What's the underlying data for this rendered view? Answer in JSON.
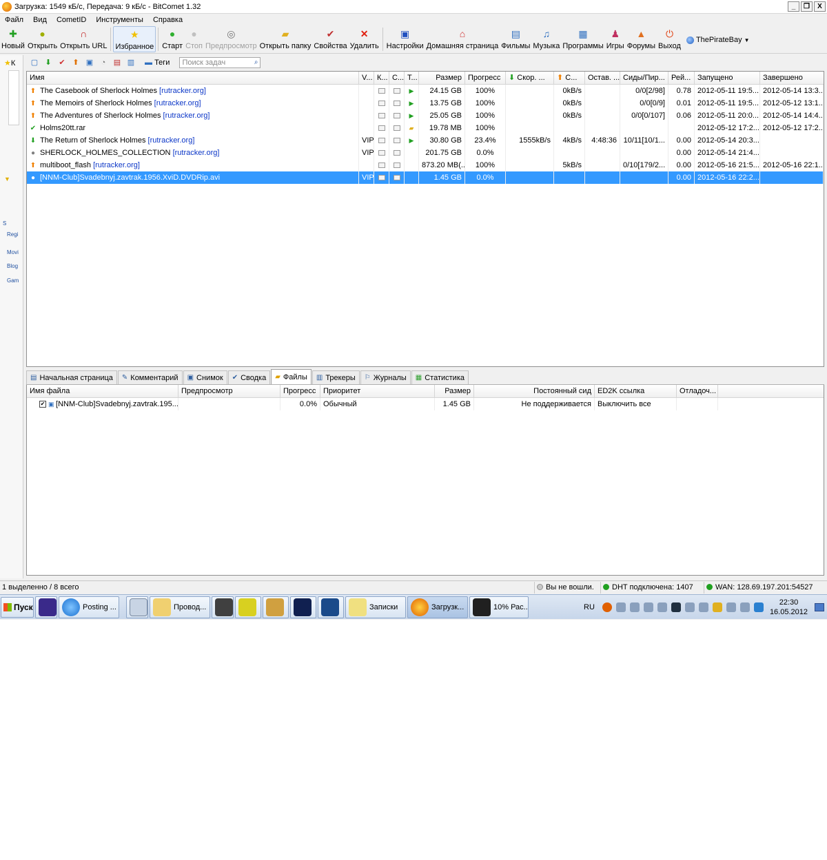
{
  "window": {
    "title": "Загрузка: 1549 кБ/с, Передача: 9 кБ/с - BitComet 1.32",
    "controls": [
      "_",
      "❐",
      "X"
    ]
  },
  "menu": [
    "Файл",
    "Вид",
    "CometID",
    "Инструменты",
    "Справка"
  ],
  "toolbar": {
    "new": "Новый",
    "open": "Открыть",
    "open_url": "Открыть URL",
    "favorites": "Избранное",
    "start": "Старт",
    "stop": "Стоп",
    "preview": "Предпросмотр",
    "open_folder": "Открыть папку",
    "properties": "Свойства",
    "delete": "Удалить",
    "settings": "Настройки",
    "homepage": "Домашняя страница",
    "movies": "Фильмы",
    "music": "Музыка",
    "programs": "Программы",
    "games": "Игры",
    "forums": "Форумы",
    "exit": "Выход",
    "site": "ThePirateBay"
  },
  "sidebar": {
    "label_k": "К",
    "items": [
      "S",
      "Regi",
      "Movi",
      "Blog",
      "Gam"
    ]
  },
  "tasks_toolbar": {
    "tags_label": "Теги",
    "search_placeholder": "Поиск задач"
  },
  "task_columns": [
    "Имя",
    "V...",
    "К...",
    "С...",
    "Т...",
    "Размер",
    "Прогресс",
    "Скор. ...",
    "С...",
    "Остав. ...",
    "Сиды/Пир...",
    "Рей...",
    "Запущено",
    "Завершено"
  ],
  "tasks": [
    {
      "state": "up",
      "name": "The Casebook of Sherlock Holmes",
      "tag": "[rutracker.org]",
      "vip": "",
      "t": "play",
      "size": "24.15 GB",
      "progress": "100%",
      "down": "",
      "up": "0kB/s",
      "left": "",
      "seeds": "0/0[2/98]",
      "ratio": "0.78",
      "started": "2012-05-11 19:5...",
      "finished": "2012-05-14 13:3..."
    },
    {
      "state": "up",
      "name": "The Memoirs of Sherlock Holmes",
      "tag": "[rutracker.org]",
      "vip": "",
      "t": "play",
      "size": "13.75 GB",
      "progress": "100%",
      "down": "",
      "up": "0kB/s",
      "left": "",
      "seeds": "0/0[0/9]",
      "ratio": "0.01",
      "started": "2012-05-11 19:5...",
      "finished": "2012-05-12 13:1..."
    },
    {
      "state": "up",
      "name": "The Adventures of Sherlock Holmes",
      "tag": "[rutracker.org]",
      "vip": "",
      "t": "play",
      "size": "25.05 GB",
      "progress": "100%",
      "down": "",
      "up": "0kB/s",
      "left": "",
      "seeds": "0/0[0/107]",
      "ratio": "0.06",
      "started": "2012-05-11 20:0...",
      "finished": "2012-05-14 14:4..."
    },
    {
      "state": "done",
      "name": "Holms20tt.rar",
      "tag": "",
      "vip": "",
      "t": "folder",
      "size": "19.78 MB",
      "progress": "100%",
      "down": "",
      "up": "",
      "left": "",
      "seeds": "",
      "ratio": "",
      "started": "2012-05-12 17:2...",
      "finished": "2012-05-12 17:2..."
    },
    {
      "state": "down",
      "name": "The Return of Sherlock Holmes",
      "tag": "[rutracker.org]",
      "vip": "VIP",
      "t": "play",
      "size": "30.80 GB",
      "progress": "23.4%",
      "down": "1555kB/s",
      "up": "4kB/s",
      "left": "4:48:36",
      "seeds": "10/11[10/1...",
      "ratio": "0.00",
      "started": "2012-05-14 20:3...",
      "finished": ""
    },
    {
      "state": "stop",
      "name": "SHERLOCK_HOLMES_COLLECTION",
      "tag": "[rutracker.org]",
      "vip": "VIP",
      "t": "",
      "size": "201.75 GB",
      "progress": "0.0%",
      "down": "",
      "up": "",
      "left": "",
      "seeds": "",
      "ratio": "0.00",
      "started": "2012-05-14 21:4...",
      "finished": ""
    },
    {
      "state": "up",
      "name": "multiboot_flash",
      "tag": "[rutracker.org]",
      "vip": "",
      "t": "",
      "size": "873.20 MB(...",
      "progress": "100%",
      "down": "",
      "up": "5kB/s",
      "left": "",
      "seeds": "0/10[179/2...",
      "ratio": "0.00",
      "started": "2012-05-16 21:5...",
      "finished": "2012-05-16 22:1..."
    },
    {
      "state": "stop",
      "name": "[NNM-Club]Svadebnyj.zavtrak.1956.XviD.DVDRip.avi",
      "tag": "",
      "vip": "VIP",
      "t": "",
      "size": "1.45 GB",
      "progress": "0.0%",
      "down": "",
      "up": "",
      "left": "",
      "seeds": "",
      "ratio": "0.00",
      "started": "2012-05-16 22:2...",
      "finished": "",
      "selected": true
    }
  ],
  "tabs": [
    "Начальная страница",
    "Комментарий",
    "Снимок",
    "Сводка",
    "Файлы",
    "Трекеры",
    "Журналы",
    "Статистика"
  ],
  "active_tab": "Файлы",
  "file_columns": [
    "Имя файла",
    "Предпросмотр",
    "Прогресс",
    "Приоритет",
    "Размер",
    "Постоянный сид",
    "ED2K ссылка",
    "Отладоч..."
  ],
  "files": [
    {
      "name": "[NNM-Club]Svadebnyj.zavtrak.195...",
      "preview": "",
      "progress": "0.0%",
      "priority": "Обычный",
      "size": "1.45 GB",
      "seed": "Не поддерживается",
      "ed2k": "Выключить все",
      "debug": ""
    }
  ],
  "statusbar": {
    "selection": "1 выделенно / 8 всего",
    "login": "Вы не вошли.",
    "dht": "DHT подключена: 1407",
    "wan": "WAN: 128.69.197.201:54527"
  },
  "taskbar": {
    "start": "Пуск",
    "buttons": [
      "Posting ...",
      "Провод...",
      "Записки",
      "Загрузк...",
      "10% Рас..."
    ],
    "lang": "RU",
    "time": "22:30",
    "date": "16.05.2012"
  },
  "colors": {
    "selection": "#3399ff",
    "tag_link": "#0b36c7",
    "accent_orange": "#f08000",
    "accent_green": "#22a022"
  }
}
